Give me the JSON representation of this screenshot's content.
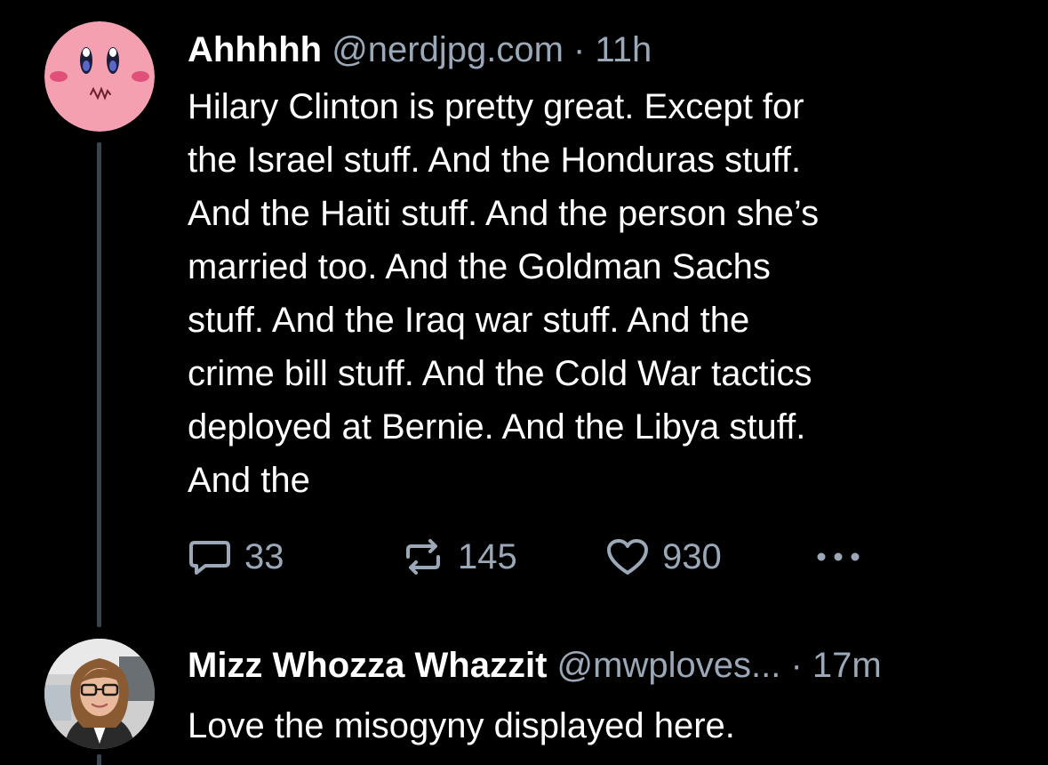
{
  "posts": [
    {
      "display_name": "Ahhhhh",
      "handle": "@nerdjpg.com",
      "separator": "·",
      "time": "11h",
      "avatar": "kirby-avatar-icon",
      "text": "Hilary Clinton is pretty great. Except for\nthe Israel stuff. And the Honduras stuff.\nAnd the Haiti stuff. And the person she’s\nmarried too. And the Goldman Sachs\nstuff. And the Iraq war stuff. And the\ncrime bill stuff. And the Cold War tactics\ndeployed at Bernie. And the Libya stuff.\nAnd the",
      "replies": "33",
      "reposts": "145",
      "likes": "930"
    },
    {
      "display_name": "Mizz Whozza Whazzit",
      "handle": "@mwploves...",
      "separator": "·",
      "time": "17m",
      "avatar": "profile-photo-avatar",
      "text": "Love the misogyny displayed here."
    }
  ],
  "colors": {
    "background": "#000000",
    "text_primary": "#ffffff",
    "text_secondary": "#9aa8b7",
    "thread_line": "#3a4450"
  }
}
